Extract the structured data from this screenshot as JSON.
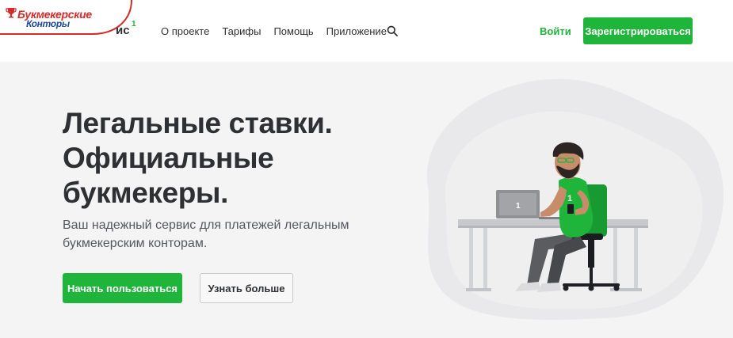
{
  "header": {
    "badge_line1": "Букмекерские",
    "badge_line2": "Конторы",
    "logo_tail": "ис",
    "logo_mark": "1",
    "nav": [
      "О проекте",
      "Тарифы",
      "Помощь",
      "Приложение"
    ],
    "login_label": "Войти",
    "register_label": "Зарегистрироваться"
  },
  "hero": {
    "title_line1": "Легальные ставки.",
    "title_line2": "Официальные",
    "title_line3": "букмекеры.",
    "subtitle_line1": "Ваш надежный сервис для платежей легальным",
    "subtitle_line2": "букмекерским конторам.",
    "primary_button": "Начать пользоваться",
    "secondary_button": "Узнать больше"
  },
  "illustration": {
    "laptop_mark": "1",
    "shirt_number": "1"
  },
  "colors": {
    "accent": "#1eb53a",
    "text": "#2f3033",
    "background": "#f4f4f5",
    "badge_red": "#d42a2a",
    "badge_blue": "#1f4a9c"
  }
}
